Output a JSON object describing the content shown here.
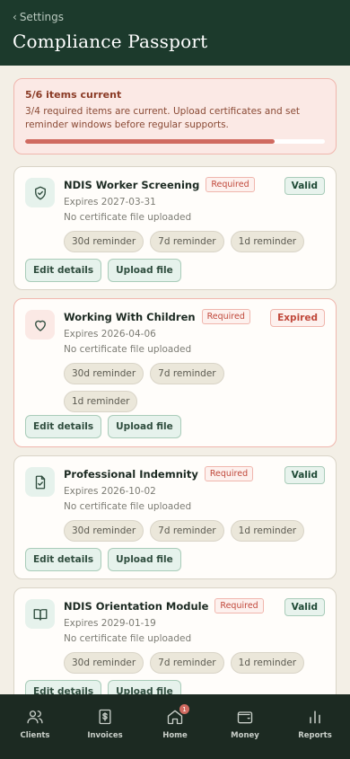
{
  "header": {
    "back_label": "Settings",
    "title": "Compliance Passport"
  },
  "summary": {
    "count_text": "5/6 items current",
    "description": "3/4 required items are current. Upload certificates and set reminder windows before regular supports.",
    "progress_fraction": 0.833
  },
  "items": [
    {
      "title": "NDIS Worker Screening",
      "required_label": "Required",
      "status": "Valid",
      "expires": "Expires 2027-03-31",
      "file_status": "No certificate file uploaded",
      "reminders": [
        "30d reminder",
        "7d reminder",
        "1d reminder"
      ],
      "edit_label": "Edit details",
      "upload_label": "Upload file",
      "icon": "shield-check-icon"
    },
    {
      "title": "Working With Children",
      "required_label": "Required",
      "status": "Expired",
      "expires": "Expires 2026-04-06",
      "file_status": "No certificate file uploaded",
      "reminders": [
        "30d reminder",
        "7d reminder",
        "1d reminder"
      ],
      "edit_label": "Edit details",
      "upload_label": "Upload file",
      "icon": "heart-icon"
    },
    {
      "title": "Professional Indemnity",
      "required_label": "Required",
      "status": "Valid",
      "expires": "Expires 2026-10-02",
      "file_status": "No certificate file uploaded",
      "reminders": [
        "30d reminder",
        "7d reminder",
        "1d reminder"
      ],
      "edit_label": "Edit details",
      "upload_label": "Upload file",
      "icon": "document-check-icon"
    },
    {
      "title": "NDIS Orientation Module",
      "required_label": "Required",
      "status": "Valid",
      "expires": "Expires 2029-01-19",
      "file_status": "No certificate file uploaded",
      "reminders": [
        "30d reminder",
        "7d reminder",
        "1d reminder"
      ],
      "edit_label": "Edit details",
      "upload_label": "Upload file",
      "icon": "book-icon"
    }
  ],
  "tabbar": {
    "tabs": [
      {
        "label": "Clients",
        "icon": "users-icon"
      },
      {
        "label": "Invoices",
        "icon": "invoice-icon"
      },
      {
        "label": "Home",
        "icon": "home-icon",
        "badge": "1"
      },
      {
        "label": "Money",
        "icon": "wallet-icon"
      },
      {
        "label": "Reports",
        "icon": "bar-chart-icon"
      }
    ]
  },
  "colors": {
    "header_bg": "#1c3a2c",
    "tabbar_bg": "#1c2a22",
    "accent_green": "#2f4d3e",
    "alert_red": "#c0483b",
    "page_bg": "#f3efe6"
  }
}
